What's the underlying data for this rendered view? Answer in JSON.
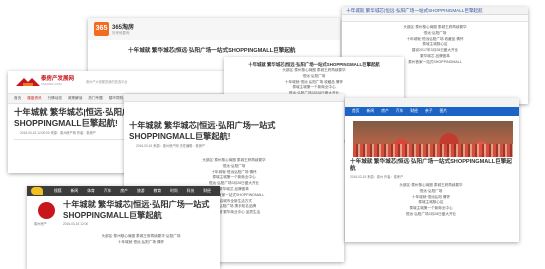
{
  "headline": "十年城就 繁华城芯|恒远·弘阳广场一站式SHOPPINGMALL巨擎起航",
  "w1": {
    "logo": "365",
    "brand": "365淘房",
    "slogan": "好房就要淘",
    "title": "十年城就 繁华城芯|恒远·弘阳广场一站式SHOPPINGMALL巨擎起航"
  },
  "w2": {
    "title": "十年城就 繁华城芯|恒远·弘阳广场一站式SHOPPINGMALL巨擎起航",
    "lines": [
      "头部区·泰州核心商圈 泰城王府再续繁华",
      "恒远·弘阳广场",
      "十年城就·恒远弘阳广场 收藏品 情怀",
      "泰城主城核心区",
      "建设2017年3月28日盛大开业",
      "繁华城芯 品牌荟萃",
      "泰州首家一站式SHOPPINGMALL"
    ]
  },
  "w3": {
    "brand": "泰房产发展网",
    "brand_sub": "TAIFANG.COM",
    "slogan": "泰州产大家都是我的首选平台",
    "nav": [
      "首页",
      "楼盘资讯",
      "行情动态",
      "政策解读",
      "热门专题",
      "楼市导购",
      "房产",
      "家居",
      "论坛"
    ],
    "nav_active": 1,
    "title": "十年城就 繁华城芯|恒远·弘阳广场一站式SHOPPINGMALL巨擎起航!",
    "meta": "2016-03-15 12:00:00    来源：泰州房产网    作者：泰房产"
  },
  "w4": {
    "title": "十年城就 繁华城芯|恒远·弘阳广场一站式SHOPPINGMALL巨擎起航",
    "lines": [
      "头部区·泰州核心商圈 泰城王府再续繁华",
      "恒远·弘阳广场",
      "十年城就·恒远 弘阳广场 收藏品 情怀",
      "",
      "泰城主城第一个新商业中心",
      "恒远·弘阳广场3月28日盛大开业",
      "繁华城芯 品牌荟萃"
    ]
  },
  "w5": {
    "title": "十年城就 繁华城芯|恒远·弘阳广场一站式SHOPPINGMALL巨擎起航!",
    "meta": "2016-03-15    来源：泰州房产网    责任编辑：泰房产",
    "lines": [
      "头部区·泰州核心商圈 泰城王府再续繁华",
      "恒远·弘阳广场",
      "十年城就·恒远弘阳广场 情怀",
      "",
      "泰城主城第一个新商业中心",
      "恒远·弘阳广场3月28日盛大开业",
      "繁华城芯 品牌荟萃",
      "打造泰州首家一站式SHOPPINGMALL",
      "开启城市全新生活方式",
      "恒远弘阳广场 携手知名品牌",
      "泰城主城 繁华商业中心 品质生活"
    ]
  },
  "w6": {
    "nav": [
      "首页",
      "新闻",
      "房产",
      "汽车",
      "财经",
      "亲子",
      "图片"
    ],
    "title": "十年城就 繁华城芯|恒远·弘阳广场一站式SHOPPINGMALL巨擎起航",
    "meta": "2016-03-15 来源：泰州 作者：泰房产",
    "lines": [
      "头部区·泰州核心商圈 泰城王府再续繁华",
      "恒远·弘阳广场",
      "十年城就·恒远弘阳 情怀",
      "泰城主城核心区",
      "泰城主城第一个新商业中心",
      "恒远·弘阳广场3月28日盛大开业"
    ]
  },
  "w7": {
    "nav": [
      "搜狐",
      "新闻",
      "体育",
      "汽车",
      "房产",
      "旅游",
      "教育",
      "时尚",
      "科技",
      "财经",
      "娱乐"
    ],
    "author": "泰州房产",
    "title": "十年城就 繁华城芯|恒远·弘阳广场一站式SHOPPINGMALL巨擎起航",
    "meta": "2016-03-15 12:00",
    "lines": [
      "头部区·泰州核心商圈 泰城王府再续繁华·弘阳广场",
      "",
      "十年城就·恒远 弘阳广场 情怀"
    ]
  }
}
